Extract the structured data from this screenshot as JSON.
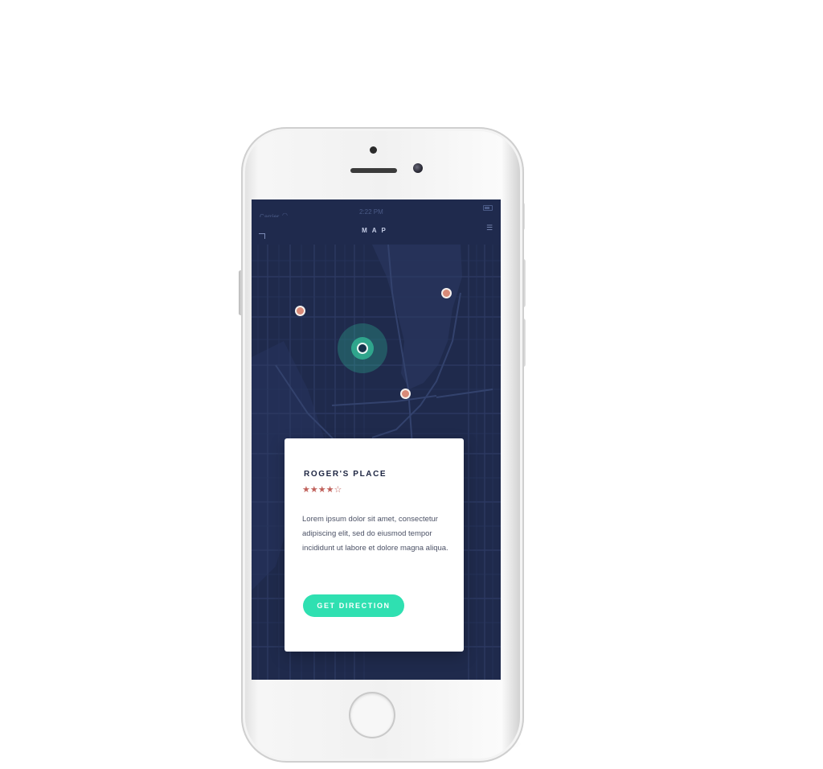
{
  "status_bar": {
    "carrier": "Carrier",
    "time": "2:22 PM",
    "wifi_icon": "wifi-icon",
    "battery_icon": "battery-icon"
  },
  "nav": {
    "title": "MAP",
    "back_icon": "back-arrow-icon",
    "menu_icon": "menu-icon"
  },
  "map": {
    "background_color": "#1f2a4d",
    "pin_color": "#d88a78",
    "user_location_color": "#2fc9a0"
  },
  "place_card": {
    "name": "ROGER'S PLACE",
    "rating_stars": "★★★★☆",
    "rating_value": 4,
    "rating_max": 5,
    "description": "Lorem ipsum dolor sit amet, consectetur adipiscing elit, sed do eiusmod tempor incididunt ut labore et dolore magna aliqua.",
    "button_label": "GET DIRECTION",
    "button_color": "#2fe0b1",
    "star_color": "#c0605a"
  }
}
